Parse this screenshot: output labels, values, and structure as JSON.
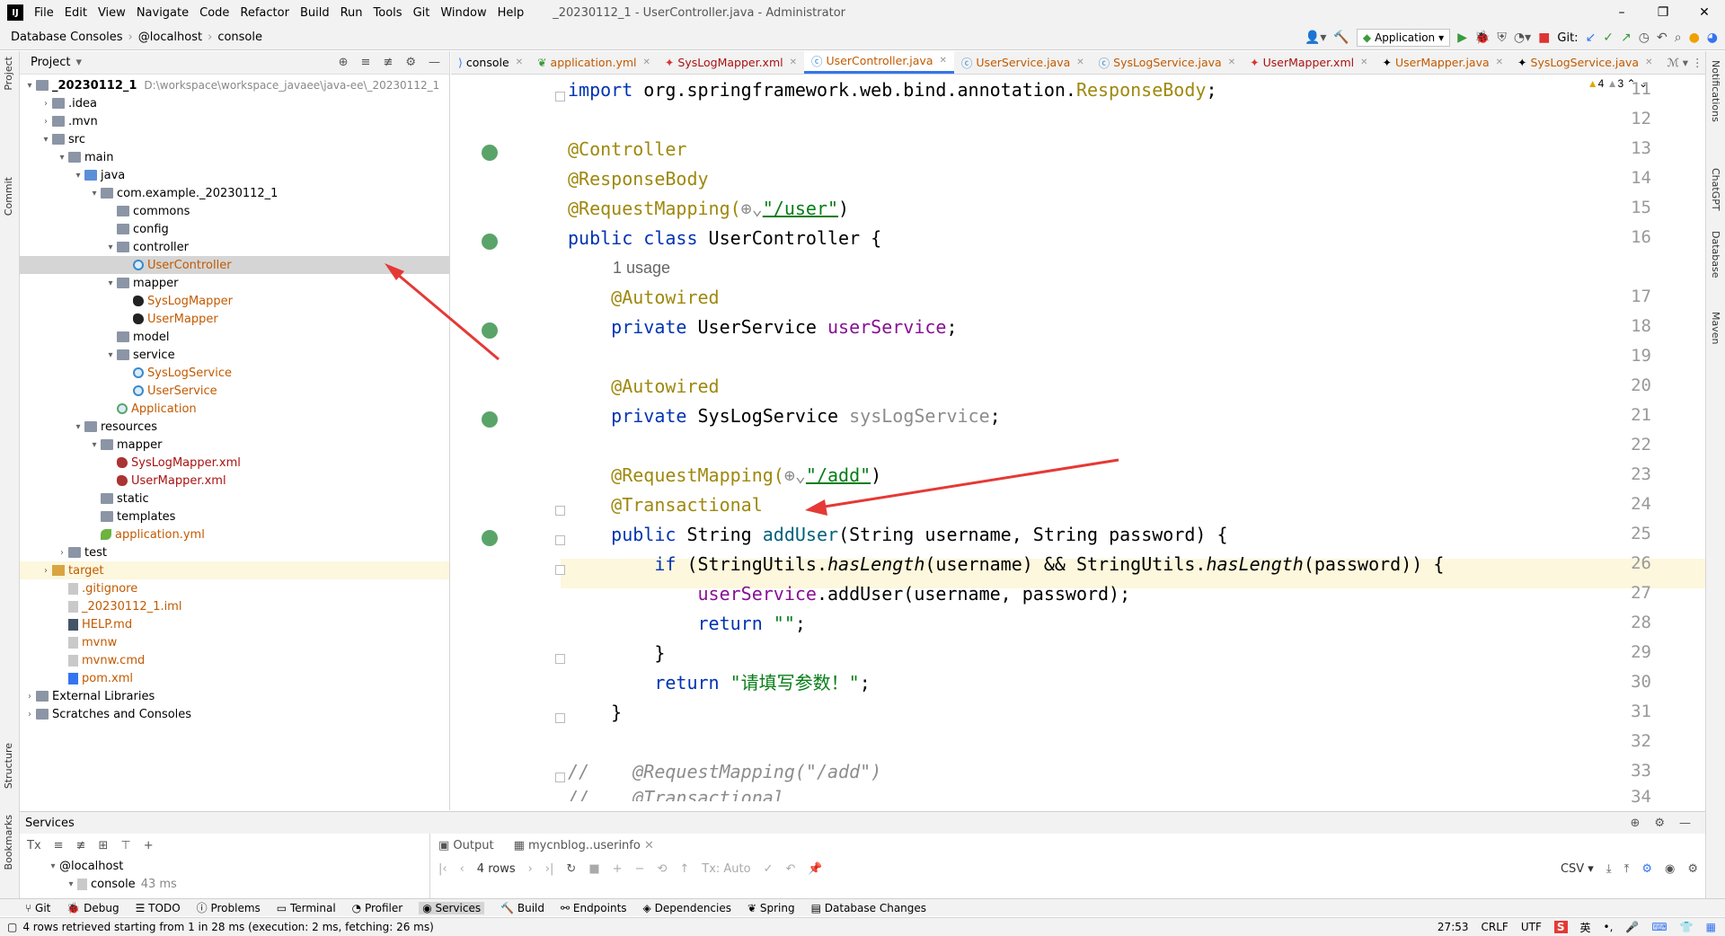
{
  "menubar": {
    "items": [
      "File",
      "Edit",
      "View",
      "Navigate",
      "Code",
      "Refactor",
      "Build",
      "Run",
      "Tools",
      "Git",
      "Window",
      "Help"
    ],
    "window_title": "_20230112_1 - UserController.java - Administrator"
  },
  "navbar": {
    "crumbs": [
      "Database Consoles",
      "@localhost",
      "console"
    ],
    "run_config": "Application",
    "git_label": "Git:"
  },
  "left_strip": [
    "Project",
    "Commit",
    "Structure",
    "Bookmarks"
  ],
  "right_strip": [
    "Notifications",
    "ChatGPT",
    "Database",
    "Maven"
  ],
  "project": {
    "title": "Project",
    "root": {
      "name": "_20230112_1",
      "path": "D:\\workspace\\workspace_javaee\\java-ee\\_20230112_1"
    },
    "rows": [
      {
        "label": ".idea"
      },
      {
        "label": ".mvn"
      },
      {
        "label": "src"
      },
      {
        "label": "main"
      },
      {
        "label": "java"
      },
      {
        "label": "com.example._20230112_1"
      },
      {
        "label": "commons"
      },
      {
        "label": "config"
      },
      {
        "label": "controller"
      },
      {
        "label": "UserController"
      },
      {
        "label": "mapper"
      },
      {
        "label": "SysLogMapper"
      },
      {
        "label": "UserMapper"
      },
      {
        "label": "model"
      },
      {
        "label": "service"
      },
      {
        "label": "SysLogService"
      },
      {
        "label": "UserService"
      },
      {
        "label": "Application"
      },
      {
        "label": "resources"
      },
      {
        "label": "mapper"
      },
      {
        "label": "SysLogMapper.xml"
      },
      {
        "label": "UserMapper.xml"
      },
      {
        "label": "static"
      },
      {
        "label": "templates"
      },
      {
        "label": "application.yml"
      },
      {
        "label": "test"
      },
      {
        "label": "target"
      },
      {
        "label": ".gitignore"
      },
      {
        "label": "_20230112_1.iml"
      },
      {
        "label": "HELP.md"
      },
      {
        "label": "mvnw"
      },
      {
        "label": "mvnw.cmd"
      },
      {
        "label": "pom.xml"
      },
      {
        "label": "External Libraries"
      },
      {
        "label": "Scratches and Consoles"
      }
    ]
  },
  "tabs": [
    "console",
    "application.yml",
    "SysLogMapper.xml",
    "UserController.java",
    "UserService.java",
    "SysLogService.java",
    "UserMapper.xml",
    "UserMapper.java",
    "SysLogService.java"
  ],
  "editor_status": {
    "warnings": "4",
    "weak_warnings": "3"
  },
  "code": {
    "line_numbers": [
      "11",
      "12",
      "13",
      "14",
      "15",
      "16",
      "17",
      "18",
      "19",
      "20",
      "21",
      "22",
      "23",
      "24",
      "25",
      "26",
      "27",
      "28",
      "29",
      "30",
      "31",
      "32",
      "33",
      "34"
    ],
    "import_kw": "import",
    "import_pkg": "org.springframework.web.bind.annotation.",
    "import_cls": "ResponseBody",
    "ann_controller": "@Controller",
    "ann_responsebody": "@ResponseBody",
    "ann_reqmap": "@RequestMapping(",
    "path_user": "\"/user\"",
    "class_decl_kw": "public class",
    "class_name": "UserController {",
    "usage_hint": "1 usage",
    "ann_autowired": "@Autowired",
    "private_kw": "private",
    "type_userservice": "UserService",
    "field_userservice": "userService",
    "type_syslogservice": "SysLogService",
    "field_syslogservice": "sysLogService",
    "path_add": "\"/add\"",
    "ann_transactional": "@Transactional",
    "public_kw": "public",
    "method_sig_type": "String",
    "method_name": "addUser",
    "method_params": "(String username, String password) {",
    "if_kw": "if",
    "if_cond_a": "(StringUtils.",
    "has_length": "hasLength",
    "if_cond_b": "(username) && StringUtils.",
    "if_cond_c": "(password)) {",
    "call_rest": ".addUser(username, password);",
    "return_kw": "return",
    "empty_str": "\"\"",
    "err_str": "\"请填写参数！\"",
    "close_brace": "}",
    "comment_33": "//    @RequestMapping(\"/add\")",
    "comment_34": "//    @Transactional"
  },
  "services": {
    "title": "Services",
    "tree": [
      {
        "label": "@localhost"
      },
      {
        "label": "console",
        "time": "43 ms"
      }
    ],
    "tabs": [
      "Output",
      "mycnblog..userinfo"
    ],
    "rows_label": "4 rows",
    "tx_label": "Tx: Auto",
    "csv_label": "CSV"
  },
  "bottom_tools": [
    "Git",
    "Debug",
    "TODO",
    "Problems",
    "Terminal",
    "Profiler",
    "Services",
    "Build",
    "Endpoints",
    "Dependencies",
    "Spring",
    "Database Changes"
  ],
  "status": {
    "message": "4 rows retrieved starting from 1 in 28 ms (execution: 2 ms, fetching: 26 ms)",
    "position": "27:53",
    "line_sep": "CRLF",
    "encoding": "UTF",
    "ime": "英"
  }
}
